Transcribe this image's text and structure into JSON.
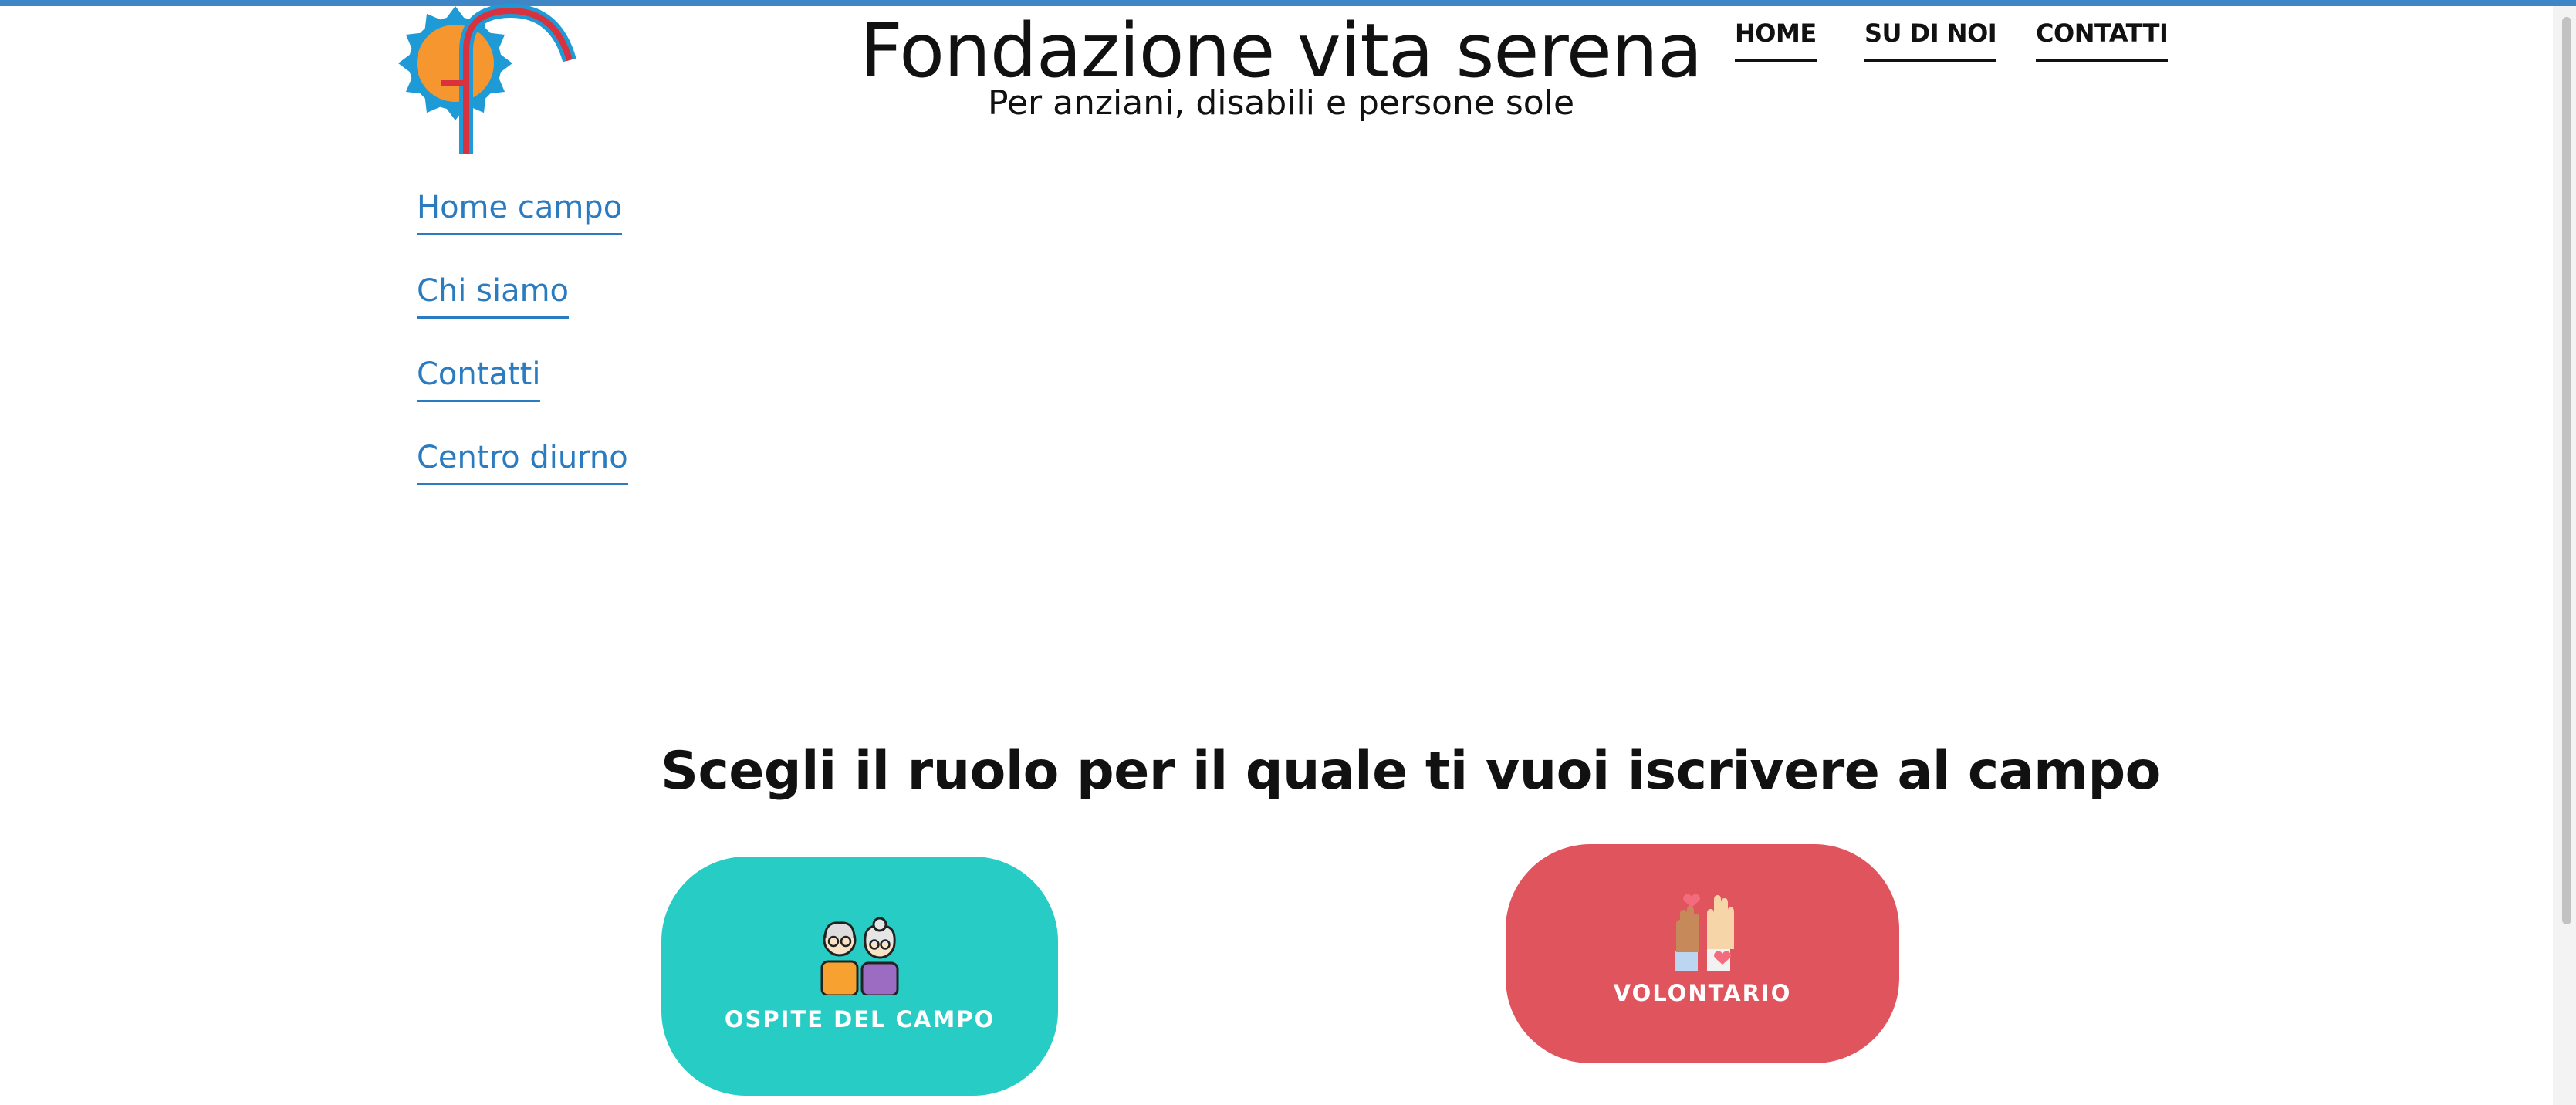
{
  "header": {
    "title": "Fondazione vita serena",
    "tagline": "Per anziani, disabili e persone sole",
    "logo_icon": "sun-cane-logo"
  },
  "top_nav": {
    "home": "HOME",
    "about": "SU DI NOI",
    "contact": "CONTATTI"
  },
  "side_nav": {
    "items": [
      "Home campo",
      "Chi siamo",
      "Contatti",
      "Centro diurno"
    ]
  },
  "main": {
    "heading": "Scegli il ruolo per il quale ti vuoi iscrivere al campo",
    "roles": [
      {
        "label": "OSPITE DEL CAMPO",
        "icon": "elderly-couple-icon",
        "color": "#27ccc5"
      },
      {
        "label": "VOLONTARIO",
        "icon": "raised-hands-icon",
        "color": "#df545d"
      }
    ]
  },
  "colors": {
    "accent": "#3f86c6",
    "link": "#2b7bc0"
  }
}
